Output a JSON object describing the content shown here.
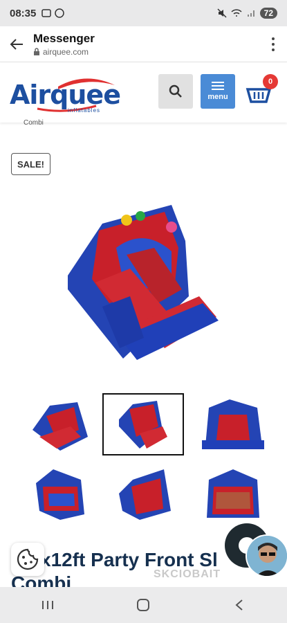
{
  "status": {
    "time": "08:35",
    "battery": "72"
  },
  "appbar": {
    "title": "Messenger",
    "url": "airquee.com"
  },
  "header": {
    "logo_text": "Airquee",
    "logo_sub": "inflatables",
    "menu_label": "menu",
    "cart_count": "0",
    "colors": {
      "brand_blue": "#1d4fa0",
      "brand_red": "#e03131",
      "menu_blue": "#4a8bd6"
    }
  },
  "breadcrumb": "Combi",
  "product": {
    "badge": "SALE!",
    "title_line1": "x12ft Party Front Sl",
    "title_line2": "Combi"
  },
  "watermark": "SKCIOBAIT",
  "icons": {
    "back": "arrow-left-icon",
    "lock": "lock-icon",
    "more": "kebab-icon",
    "search": "search-icon",
    "menu": "hamburger-icon",
    "cart": "cart-icon",
    "cookie": "cookie-icon",
    "chat": "chat-bubble-icon"
  }
}
